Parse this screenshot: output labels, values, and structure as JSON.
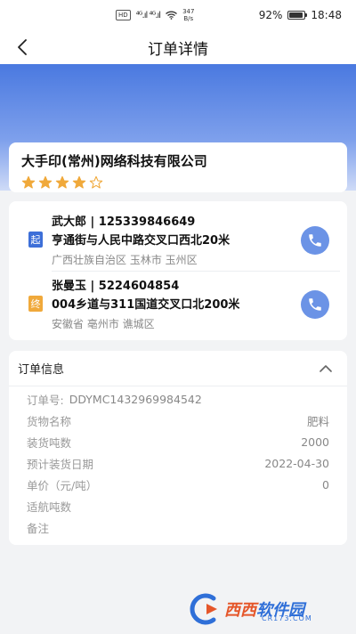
{
  "status_bar": {
    "hd": "HD",
    "signal": "⁴ᴳ.ıl ⁴ᴳ.ıl",
    "speed_value": "347",
    "speed_unit": "B/s",
    "battery_text": "92%",
    "battery_level": 0.92,
    "time": "18:48"
  },
  "nav": {
    "title": "订单详情"
  },
  "company": {
    "name": "大手印(常州)网络科技有限公司",
    "rating": 4,
    "rating_max": 5
  },
  "route": {
    "start": {
      "tag": "起",
      "contact": "武大郎 | 125339846649",
      "address": "亨通街与人民中路交叉口西北20米",
      "region": "广西壮族自治区 玉林市 玉州区"
    },
    "end": {
      "tag": "终",
      "contact": "张曼玉 | 5224604854",
      "address": "004乡道与311国道交叉口北200米",
      "region": "安徽省 亳州市 谯城区"
    }
  },
  "order": {
    "title": "订单信息",
    "order_no_label": "订单号:",
    "order_no": "DDYMC1432969984542",
    "rows": [
      {
        "label": "货物名称",
        "value": "肥料"
      },
      {
        "label": "装货吨数",
        "value": "2000"
      },
      {
        "label": "预计装货日期",
        "value": "2022-04-30"
      },
      {
        "label": "单价（元/吨）",
        "value": "0"
      },
      {
        "label": "适航吨数",
        "value": ""
      },
      {
        "label": "备注",
        "value": ""
      }
    ]
  },
  "watermark": {
    "brand_a": "西西",
    "brand_b": "软件园",
    "url": "CR173.COM"
  },
  "colors": {
    "primary": "#4a79e0",
    "start_tag": "#3d6fd8",
    "end_tag": "#f0a93b",
    "star": "#f0a93b",
    "phone": "#6b93e6"
  }
}
